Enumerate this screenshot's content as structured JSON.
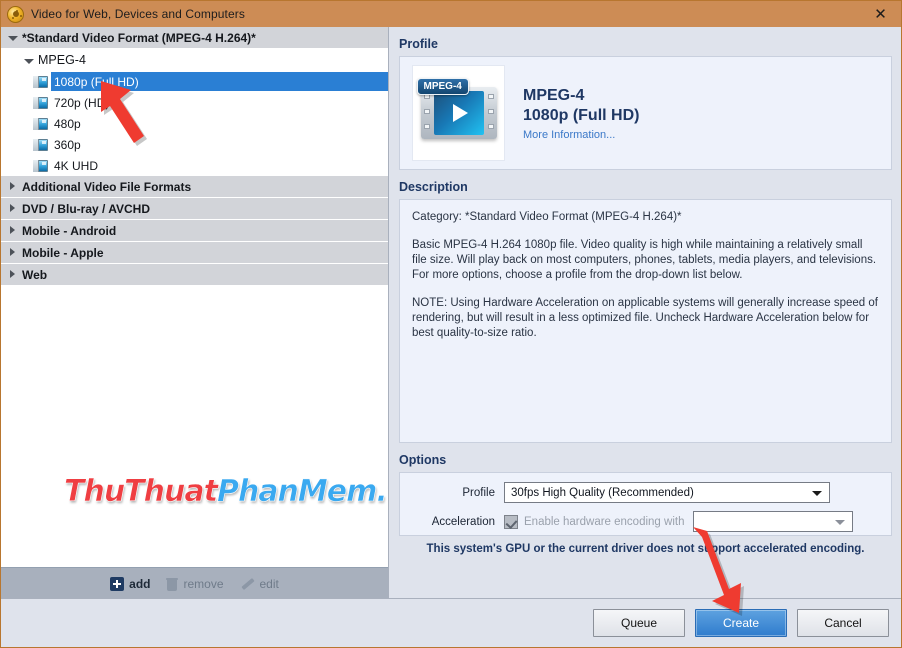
{
  "window": {
    "title": "Video for Web, Devices and Computers",
    "app_icon": "film-reel-icon",
    "close_label": "✕"
  },
  "tree": {
    "root": {
      "label": "*Standard Video Format (MPEG-4 H.264)*",
      "expanded": true
    },
    "subgroup": {
      "label": "MPEG-4",
      "expanded": true
    },
    "leaves": [
      {
        "label": "1080p (Full HD)",
        "selected": true
      },
      {
        "label": "720p (HD)",
        "selected": false
      },
      {
        "label": "480p",
        "selected": false
      },
      {
        "label": "360p",
        "selected": false
      },
      {
        "label": "4K UHD",
        "selected": false
      }
    ],
    "groups": [
      {
        "label": "Additional Video File Formats",
        "expanded": false
      },
      {
        "label": "DVD / Blu-ray / AVCHD",
        "expanded": false
      },
      {
        "label": "Mobile - Android",
        "expanded": false
      },
      {
        "label": "Mobile - Apple",
        "expanded": false
      },
      {
        "label": "Web",
        "expanded": false
      }
    ]
  },
  "watermark": {
    "part1": "ThuThuat",
    "part2": "PhanMem.vn"
  },
  "left_toolbar": {
    "add": "add",
    "remove": "remove",
    "edit": "edit"
  },
  "profile": {
    "section_label": "Profile",
    "badge": "MPEG-4",
    "title": "MPEG-4",
    "subtitle": "1080p (Full HD)",
    "more_link": "More Information..."
  },
  "description": {
    "section_label": "Description",
    "category": "Category: *Standard Video Format (MPEG-4 H.264)*",
    "paragraph1": "Basic MPEG-4 H.264 1080p file. Video quality is high while maintaining a relatively small file size. Will play back on most computers, phones, tablets, media players, and televisions. For more options, choose a profile from the drop-down list below.",
    "paragraph2": "NOTE: Using Hardware Acceleration on applicable systems will generally increase speed of rendering, but will result in a less optimized file. Uncheck Hardware Acceleration below for best quality-to-size ratio."
  },
  "options": {
    "section_label": "Options",
    "profile_label": "Profile",
    "profile_value": "30fps High Quality (Recommended)",
    "acceleration_label": "Acceleration",
    "acceleration_checkbox_label": "Enable hardware encoding with",
    "acceleration_value": "",
    "warning": "This system's GPU or the current driver does not support accelerated encoding."
  },
  "footer": {
    "queue": "Queue",
    "create": "Create",
    "cancel": "Cancel"
  },
  "colors": {
    "titlebar": "#cd8c55",
    "selection_blue": "#2a7fd4",
    "accent_heading": "#1f3864",
    "annotation_red": "#ef3b30",
    "panel_bg": "#dfe3ec",
    "content_bg": "#eef2fb"
  }
}
